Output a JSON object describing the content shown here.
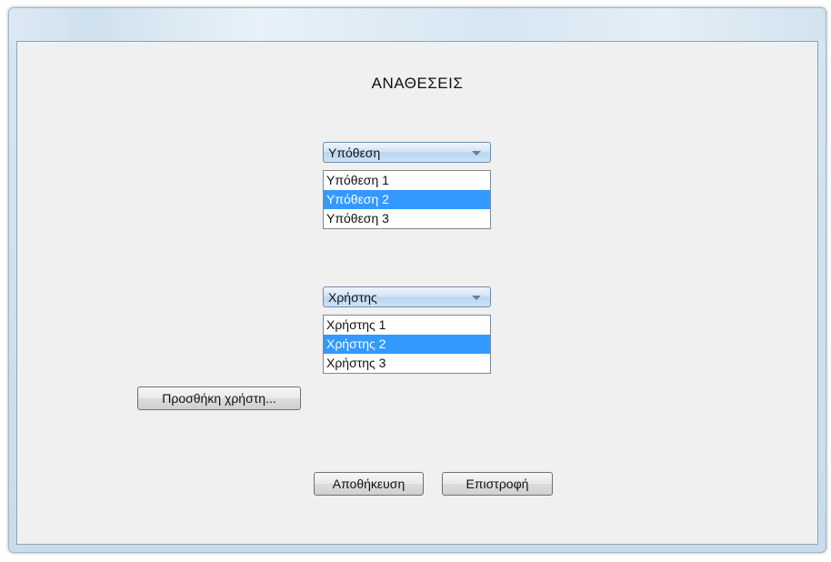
{
  "window": {
    "title": ""
  },
  "main": {
    "title": "ΑΝΑΘΕΣΕΙΣ",
    "case_combo": {
      "selected_label": "Υπόθεση",
      "options": [
        "Υπόθεση 1",
        "Υπόθεση 2",
        "Υπόθεση 3"
      ],
      "highlighted_index": 1
    },
    "user_combo": {
      "selected_label": "Χρήστης",
      "options": [
        "Χρήστης 1",
        "Χρήστης 2",
        "Χρήστης 3"
      ],
      "highlighted_index": 1
    },
    "add_user_button": "Προσθήκη χρήστη...",
    "save_button": "Αποθήκευση",
    "back_button": "Επιστροφή"
  },
  "colors": {
    "selection": "#3399ff",
    "window_frame": "#c9dceb",
    "client_background": "#f0f0f0"
  },
  "icons": {
    "combo_arrow": "chevron-down-icon"
  }
}
